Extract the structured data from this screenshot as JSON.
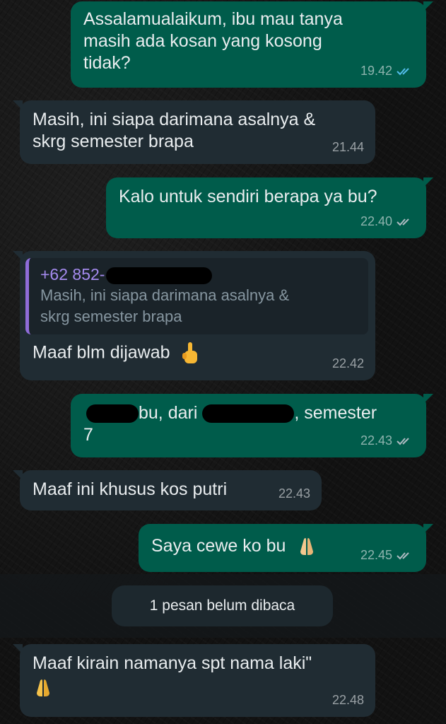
{
  "messages": [
    {
      "text_lines": [
        "Assalamualaikum, ibu mau tanya",
        "masih ada kosan yang kosong",
        "tidak?"
      ],
      "time": "19.42",
      "status": "read"
    },
    {
      "text_lines": [
        "Masih,  ini siapa darimana asalnya &",
        "skrg semester brapa"
      ],
      "time": "21.44"
    },
    {
      "text_lines": [
        "Kalo untuk sendiri berapa ya bu?"
      ],
      "time": "22.40",
      "status": "delivered"
    },
    {
      "reply_name": "+62 852-",
      "reply_lines": [
        "Masih,  ini siapa darimana asalnya &",
        "skrg semester brapa"
      ],
      "text": "Maaf blm dijawab",
      "emoji": "pointing-up-hand",
      "time": "22.42"
    },
    {
      "text_part1": "bu, dari",
      "text_part2": ", semester",
      "text_line2": "7",
      "time": "22.43",
      "status": "delivered"
    },
    {
      "text": "Maaf ini khusus kos putri",
      "time": "22.43"
    },
    {
      "text": "Saya cewe ko bu",
      "emoji": "folded-hands",
      "time": "22.45",
      "status": "delivered"
    },
    {
      "text": "Maaf kirain namanya spt nama laki\"",
      "emoji": "folded-hands",
      "time": "22.48"
    }
  ],
  "unread_banner": "1 pesan belum dibaca",
  "colors": {
    "outgoing": "#005c4b",
    "incoming": "#202c33",
    "read_tick": "#53bdeb",
    "delivered_tick": "#aebac1",
    "reply_name": "#a58bef"
  }
}
